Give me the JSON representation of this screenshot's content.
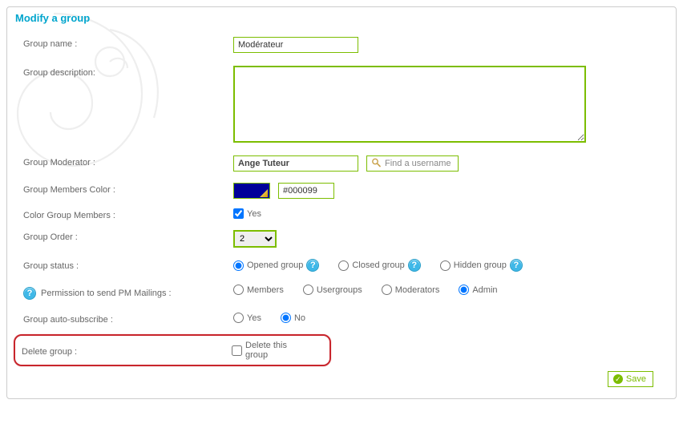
{
  "title": "Modify a group",
  "labels": {
    "group_name": "Group name :",
    "group_description": "Group description:",
    "group_moderator": "Group Moderator :",
    "group_members_color": "Group Members Color :",
    "color_group_members": "Color Group Members :",
    "group_order": "Group Order :",
    "group_status": "Group status :",
    "pm_permission": "Permission to send PM Mailings :",
    "auto_subscribe": "Group auto-subscribe :",
    "delete_group": "Delete group :"
  },
  "values": {
    "group_name": "Modérateur",
    "group_description": "",
    "moderator": "Ange Tuteur",
    "color_hex": "#000099",
    "color_swatch": "#000099",
    "color_members_yes": "Yes",
    "group_order": "2",
    "delete_label": "Delete this group"
  },
  "buttons": {
    "find_username": "Find a username",
    "save": "Save"
  },
  "status_options": {
    "opened": "Opened group",
    "closed": "Closed group",
    "hidden": "Hidden group"
  },
  "pm_options": {
    "members": "Members",
    "usergroups": "Usergroups",
    "moderators": "Moderators",
    "admin": "Admin"
  },
  "yesno": {
    "yes": "Yes",
    "no": "No"
  },
  "selected": {
    "status": "opened",
    "pm": "admin",
    "auto_subscribe": "no",
    "color_members": true,
    "delete": false
  }
}
